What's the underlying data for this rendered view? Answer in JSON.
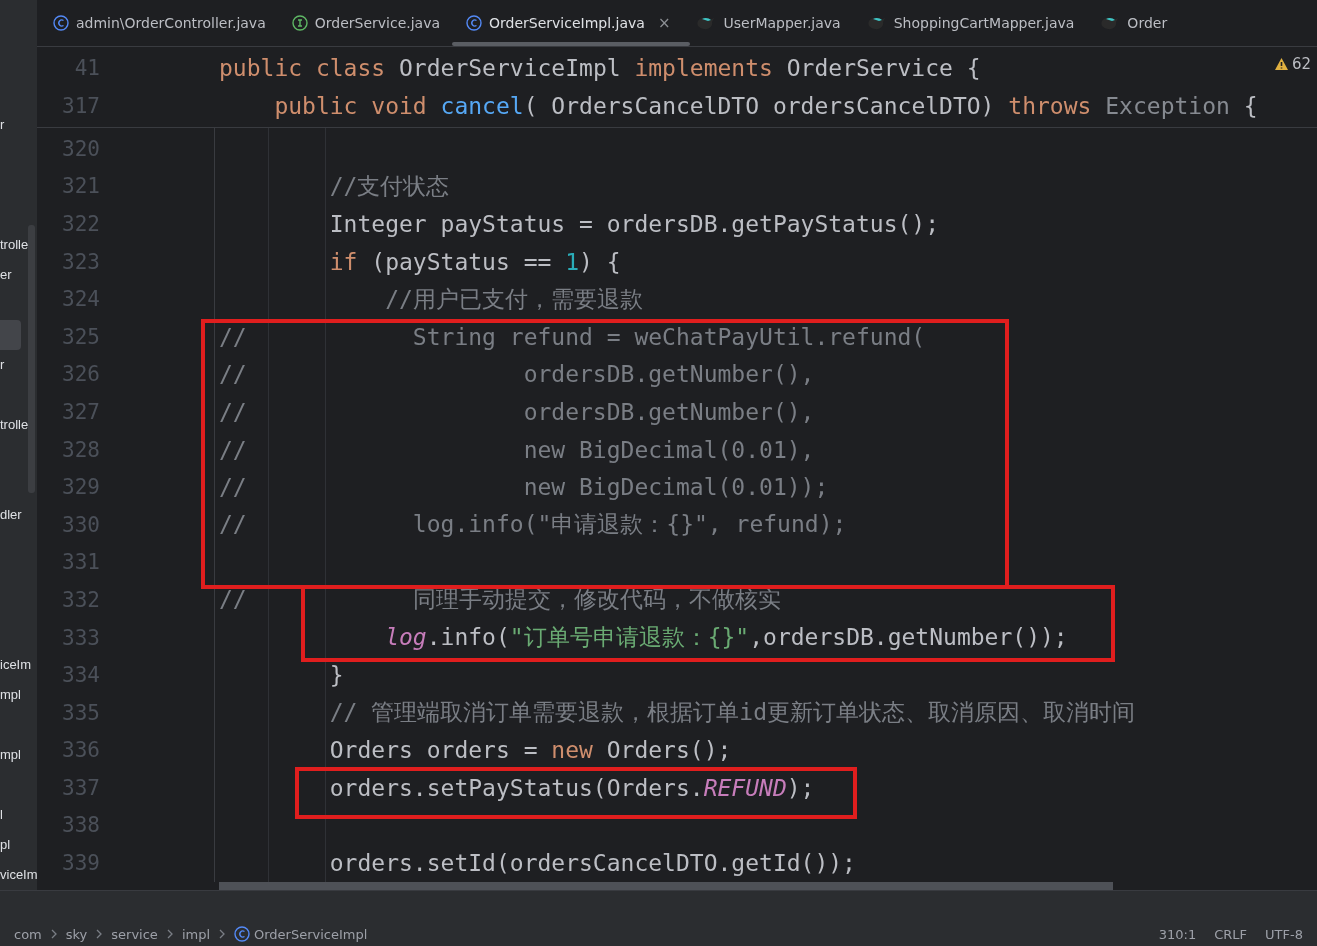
{
  "tabs": [
    {
      "label": "admin\\OrderController.java",
      "kind": "class",
      "selected": false
    },
    {
      "label": "OrderService.java",
      "kind": "interface",
      "selected": false
    },
    {
      "label": "OrderServiceImpl.java",
      "kind": "class",
      "selected": true,
      "close": "×"
    },
    {
      "label": "UserMapper.java",
      "kind": "mapper",
      "selected": false
    },
    {
      "label": "ShoppingCartMapper.java",
      "kind": "mapper",
      "selected": false
    },
    {
      "label": "Order",
      "kind": "mapper",
      "selected": false
    }
  ],
  "inspections": {
    "warnings": "62"
  },
  "sidebar": {
    "items": [
      {
        "label": "r",
        "selected": false
      },
      {
        "selected": false
      },
      {
        "selected": false
      },
      {
        "selected": false
      },
      {
        "label": "trolle",
        "selected": false
      },
      {
        "label": "er",
        "selected": false
      },
      {
        "selected": false
      },
      {
        "selected": true
      },
      {
        "label": "r",
        "selected": false
      },
      {
        "selected": false
      },
      {
        "label": "trolle",
        "selected": false
      },
      {
        "selected": false
      },
      {
        "selected": false
      },
      {
        "label": "dler",
        "selected": false
      },
      {
        "selected": false
      },
      {
        "selected": false
      },
      {
        "selected": false
      },
      {
        "selected": false
      },
      {
        "label": "iceIm",
        "selected": false
      },
      {
        "label": "mpl",
        "selected": false
      },
      {
        "selected": false
      },
      {
        "label": "mpl",
        "selected": false
      },
      {
        "selected": false
      },
      {
        "label": "l",
        "selected": false
      },
      {
        "label": "pl",
        "selected": false
      },
      {
        "label": "viceIm",
        "selected": false
      }
    ]
  },
  "sticky_lines": [
    {
      "number": "41",
      "tokens": [
        {
          "kind": "kw",
          "text": "public class "
        },
        {
          "kind": "plain",
          "text": "OrderServiceImpl "
        },
        {
          "kind": "kw",
          "text": "implements "
        },
        {
          "kind": "plain",
          "text": "OrderService {"
        }
      ]
    },
    {
      "number": "317",
      "tokens": [
        {
          "kind": "kw",
          "text": "    public void "
        },
        {
          "kind": "fn",
          "text": "cancel"
        },
        {
          "kind": "plain",
          "text": "( OrdersCancelDTO ordersCancelDTO) "
        },
        {
          "kind": "kw",
          "text": "throws "
        },
        {
          "kind": "dim",
          "text": "Exception "
        },
        {
          "kind": "plain",
          "text": "{"
        }
      ]
    }
  ],
  "lines": [
    {
      "number": "320"
    },
    {
      "number": "321",
      "tokens": [
        {
          "kind": "comment",
          "text": "        //支付状态"
        }
      ]
    },
    {
      "number": "322",
      "tokens": [
        {
          "kind": "plain",
          "text": "        Integer payStatus = ordersDB.getPayStatus();"
        }
      ]
    },
    {
      "number": "323",
      "tokens": [
        {
          "kind": "kw",
          "text": "        if "
        },
        {
          "kind": "plain",
          "text": "(payStatus == "
        },
        {
          "kind": "num",
          "text": "1"
        },
        {
          "kind": "plain",
          "text": ") {"
        }
      ]
    },
    {
      "number": "324",
      "tokens": [
        {
          "kind": "comment",
          "text": "            //用户已支付，需要退款"
        }
      ]
    },
    {
      "number": "325",
      "tokens": [
        {
          "kind": "comment",
          "text": "//            String refund = weChatPayUtil.refund("
        }
      ]
    },
    {
      "number": "326",
      "tokens": [
        {
          "kind": "comment",
          "text": "//                    ordersDB.getNumber(),"
        }
      ]
    },
    {
      "number": "327",
      "tokens": [
        {
          "kind": "comment",
          "text": "//                    ordersDB.getNumber(),"
        }
      ]
    },
    {
      "number": "328",
      "tokens": [
        {
          "kind": "comment",
          "text": "//                    new BigDecimal(0.01),"
        }
      ]
    },
    {
      "number": "329",
      "tokens": [
        {
          "kind": "comment",
          "text": "//                    new BigDecimal(0.01));"
        }
      ]
    },
    {
      "number": "330",
      "tokens": [
        {
          "kind": "comment",
          "text": "//            log.info(\"申请退款：{}\", refund);"
        }
      ]
    },
    {
      "number": "331"
    },
    {
      "number": "332",
      "tokens": [
        {
          "kind": "comment",
          "text": "//            同理手动提交，修改代码，不做核实"
        }
      ]
    },
    {
      "number": "333",
      "tokens": [
        {
          "kind": "field",
          "text": "            log"
        },
        {
          "kind": "plain",
          "text": ".info("
        },
        {
          "kind": "str",
          "text": "\"订单号申请退款：{}\""
        },
        {
          "kind": "plain",
          "text": ",ordersDB.getNumber());"
        }
      ]
    },
    {
      "number": "334",
      "tokens": [
        {
          "kind": "plain",
          "text": "        }"
        }
      ]
    },
    {
      "number": "335",
      "tokens": [
        {
          "kind": "comment",
          "text": "        // 管理端取消订单需要退款，根据订单id更新订单状态、取消原因、取消时间"
        }
      ]
    },
    {
      "number": "336",
      "tokens": [
        {
          "kind": "plain",
          "text": "        Orders orders = "
        },
        {
          "kind": "kw",
          "text": "new "
        },
        {
          "kind": "plain",
          "text": "Orders();"
        }
      ]
    },
    {
      "number": "337",
      "tokens": [
        {
          "kind": "plain",
          "text": "        orders.setPayStatus(Orders."
        },
        {
          "kind": "field",
          "text": "REFUND"
        },
        {
          "kind": "plain",
          "text": ");"
        }
      ]
    },
    {
      "number": "338"
    },
    {
      "number": "339",
      "tokens": [
        {
          "kind": "plain",
          "text": "        orders.setId(ordersCancelDTO.getId());"
        }
      ]
    }
  ],
  "breadcrumbs": [
    {
      "label": "com"
    },
    {
      "label": "sky"
    },
    {
      "label": "service"
    },
    {
      "label": "impl"
    },
    {
      "label": "OrderServiceImpl",
      "kind": "class"
    }
  ],
  "status": [
    "310:1",
    "CRLF",
    "UTF-8"
  ]
}
